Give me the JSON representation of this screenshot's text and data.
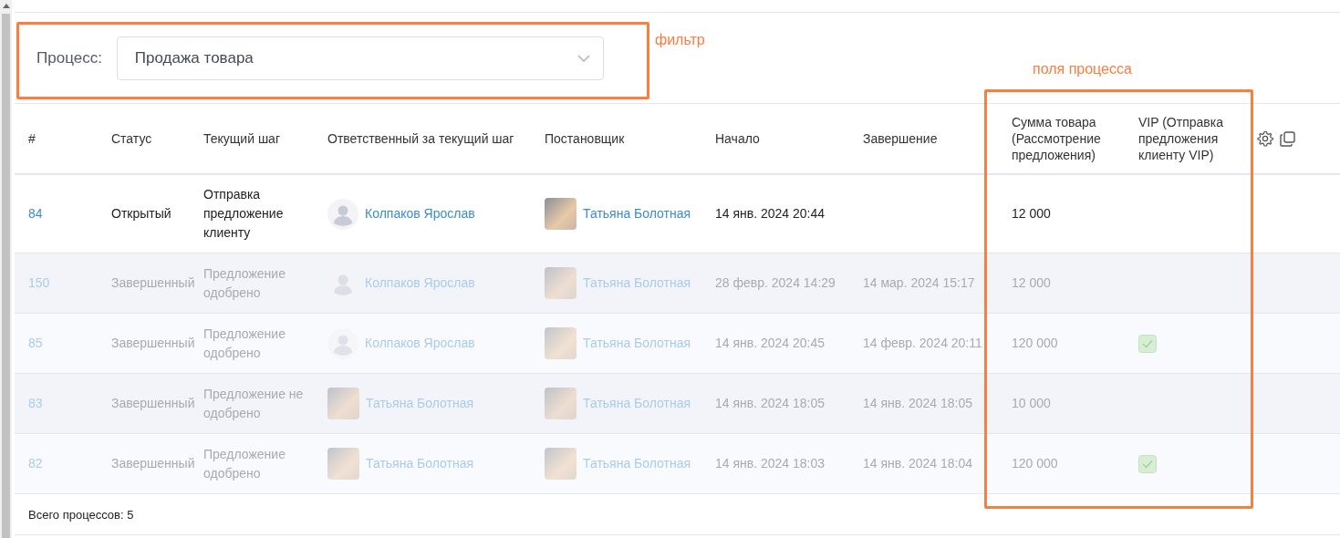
{
  "filter": {
    "label": "Процесс:",
    "value": "Продажа товара"
  },
  "annotations": [
    {
      "kind": "filter",
      "label": "фильтр"
    },
    {
      "kind": "fields",
      "label": "поля процесса"
    }
  ],
  "table": {
    "columns": [
      "#",
      "Статус",
      "Текущий шаг",
      "Ответственный за текущий шаг",
      "Постановщик",
      "Начало",
      "Завершение",
      "Сумма товара (Рассмотрение предложения)",
      "VIP (Отправка предложения клиенту VIP)"
    ],
    "rows": [
      {
        "id": "84",
        "status": "Открытый",
        "step": "Отправка предложение клиенту",
        "responsible": {
          "name": "Колпаков Ярослав",
          "kind": "silhouette"
        },
        "author": {
          "name": "Татьяна Болотная",
          "kind": "photo"
        },
        "start": "14 янв. 2024 20:44",
        "sum": "12 000",
        "vip": false,
        "completed": false
      },
      {
        "id": "150",
        "status": "Завершенный",
        "step": "Предложение одобрено",
        "responsible": {
          "name": "Колпаков Ярослав",
          "kind": "silhouette"
        },
        "author": {
          "name": "Татьяна Болотная",
          "kind": "photo"
        },
        "start": "28 февр. 2024 14:29",
        "end": "14 мар. 2024 15:17",
        "sum": "12 000",
        "vip": false,
        "completed": true
      },
      {
        "id": "85",
        "status": "Завершенный",
        "step": "Предложение одобрено",
        "responsible": {
          "name": "Колпаков Ярослав",
          "kind": "silhouette"
        },
        "author": {
          "name": "Татьяна Болотная",
          "kind": "photo"
        },
        "start": "14 янв. 2024 20:45",
        "end": "14 февр. 2024 20:11",
        "sum": "120 000",
        "vip": true,
        "completed": true
      },
      {
        "id": "83",
        "status": "Завершенный",
        "step": "Предложение не одобрено",
        "responsible": {
          "name": "Татьяна Болотная",
          "kind": "photo"
        },
        "author": {
          "name": "Татьяна Болотная",
          "kind": "photo"
        },
        "start": "14 янв. 2024 18:05",
        "end": "14 янв. 2024 18:05",
        "sum": "10 000",
        "vip": false,
        "completed": true
      },
      {
        "id": "82",
        "status": "Завершенный",
        "step": "Предложение одобрено",
        "responsible": {
          "name": "Татьяна Болотная",
          "kind": "photo"
        },
        "author": {
          "name": "Татьяна Болотная",
          "kind": "photo"
        },
        "start": "14 янв. 2024 18:03",
        "end": "14 янв. 2024 18:04",
        "sum": "120 000",
        "vip": true,
        "completed": true
      }
    ]
  },
  "footer": "Всего процессов: 5"
}
